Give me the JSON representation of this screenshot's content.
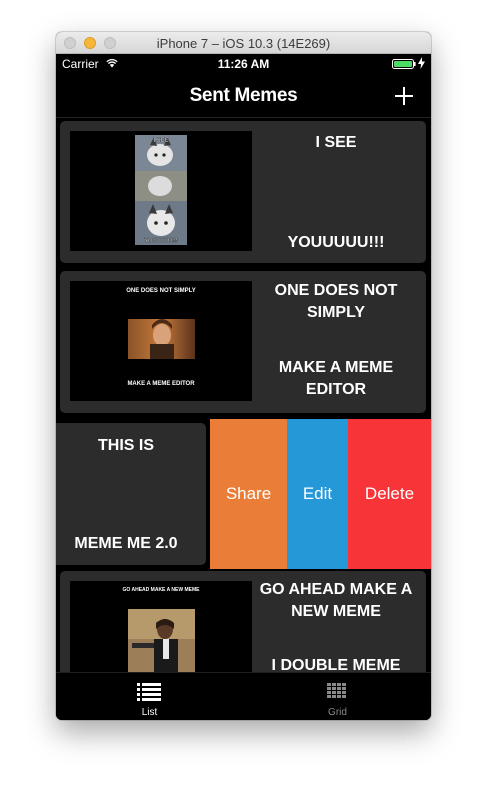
{
  "window": {
    "title": "iPhone 7 – iOS 10.3 (14E269)"
  },
  "status_bar": {
    "carrier": "Carrier",
    "time": "11:26 AM"
  },
  "nav": {
    "title": "Sent Memes",
    "add_icon": "plus-icon"
  },
  "memes": [
    {
      "top": "I SEE",
      "bottom": "YOUUUUU!!!",
      "image": "husky-meme"
    },
    {
      "top": "ONE DOES NOT SIMPLY",
      "bottom": "MAKE A MEME EDITOR",
      "image": "boromir-meme"
    },
    {
      "top": "THIS IS",
      "bottom": "MEME ME 2.0",
      "image": "none"
    },
    {
      "top": "GO AHEAD MAKE A NEW MEME",
      "bottom": "I DOUBLE MEME",
      "image": "pulp-fiction-meme"
    }
  ],
  "thumb_captions": {
    "husky_top": "I SEE",
    "husky_bottom": "YOUUUUU!!!",
    "boromir_top": "ONE DOES NOT SIMPLY",
    "boromir_bottom": "MAKE A MEME EDITOR",
    "pulp_top": "GO AHEAD MAKE A NEW MEME"
  },
  "swipe_actions": {
    "share": "Share",
    "edit": "Edit",
    "delete": "Delete"
  },
  "action_colors": {
    "share": "#ea7e38",
    "edit": "#2598d8",
    "delete": "#f73437"
  },
  "tabs": [
    {
      "label": "List",
      "icon": "list-icon",
      "selected": true
    },
    {
      "label": "Grid",
      "icon": "grid-icon",
      "selected": false
    }
  ]
}
